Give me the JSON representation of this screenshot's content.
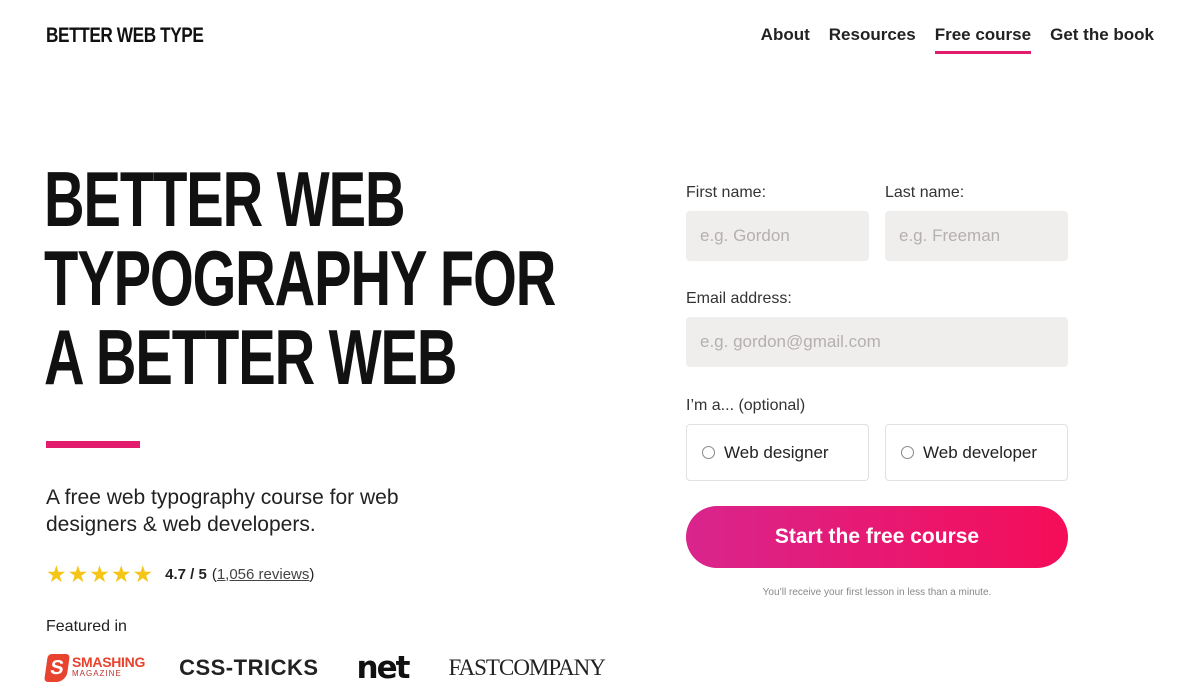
{
  "header": {
    "logo": "BETTER WEB TYPE",
    "nav": [
      {
        "label": "About",
        "active": false
      },
      {
        "label": "Resources",
        "active": false
      },
      {
        "label": "Free course",
        "active": true
      },
      {
        "label": "Get the book",
        "active": false
      }
    ]
  },
  "hero": {
    "headline_lines": [
      "BETTER WEB",
      "TYPOGRAPHY FOR",
      "A BETTER WEB"
    ],
    "tagline": "A free web typography course for web designers & web developers.",
    "rating": {
      "stars": 5,
      "value": "4.7 / 5",
      "open_paren": "(",
      "reviews": "1,056 reviews",
      "close_paren": ")"
    },
    "featured_label": "Featured in",
    "featured_logos": {
      "smashing_mark": "S",
      "smashing_big": "SMASHING",
      "smashing_small": "MAGAZINE",
      "css_tricks": "CSS-TRICKS",
      "net": "net",
      "fast_company": "FASTCOMPANY"
    }
  },
  "form": {
    "first_name_label": "First name:",
    "first_name_placeholder": "e.g. Gordon",
    "last_name_label": "Last name:",
    "last_name_placeholder": "e.g. Freeman",
    "email_label": "Email address:",
    "email_placeholder": "e.g. gordon@gmail.com",
    "role_label": "I’m a... (optional)",
    "role_options": [
      "Web designer",
      "Web developer"
    ],
    "submit_label": "Start the free course",
    "note": "You’ll receive your first lesson in less than a minute."
  },
  "colors": {
    "accent": "#e31b6d",
    "star": "#f5c518",
    "input_bg": "#f0eded"
  }
}
